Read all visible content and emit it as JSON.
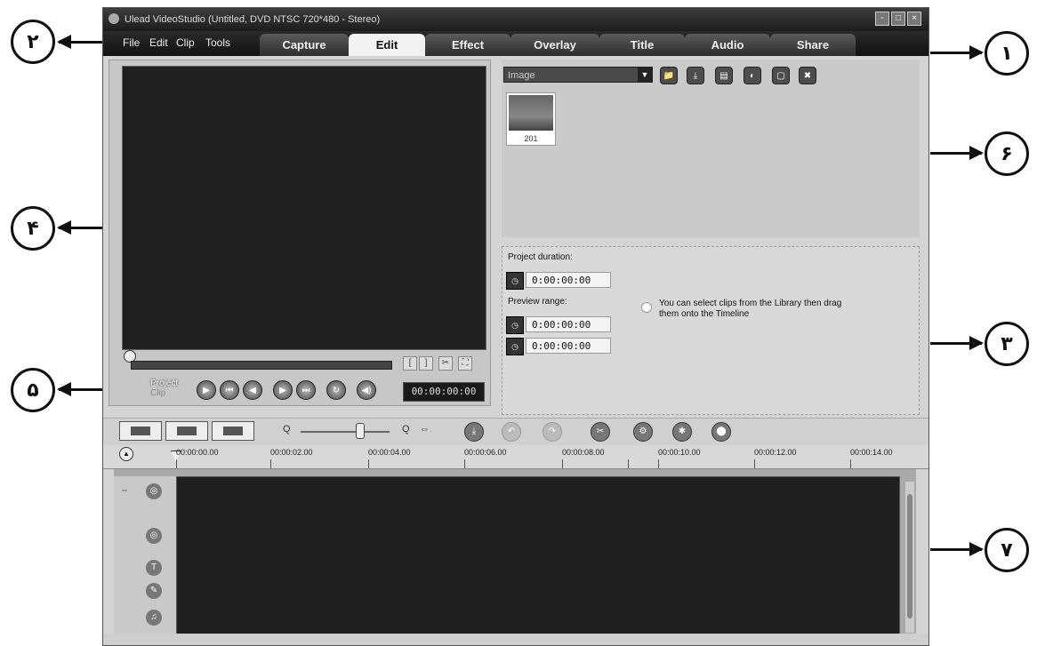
{
  "window": {
    "title": "Ulead VideoStudio (Untitled, DVD NTSC 720*480 - Stereo)",
    "buttons": [
      "-",
      "□",
      "×"
    ]
  },
  "menu": {
    "items": [
      "File",
      "Edit",
      "Clip",
      "Tools"
    ]
  },
  "tabs": {
    "items": [
      "Capture",
      "Edit",
      "Effect",
      "Overlay",
      "Title",
      "Audio",
      "Share"
    ],
    "active": "Edit"
  },
  "preview": {
    "mode_project": "Project",
    "mode_clip": "Clip",
    "timecode": "00:00:00:00",
    "trim_labels": [
      "[",
      "]"
    ],
    "buttons": [
      "play",
      "home",
      "previous-frame",
      "next-frame",
      "end",
      "repeat",
      "volume",
      "enlarge"
    ],
    "button_glyphs": [
      "▶",
      "⏮",
      "◀",
      "▶",
      "⏭",
      "↻",
      "◀)",
      "⛶"
    ]
  },
  "library": {
    "category": "Image",
    "dropdown_glyph": "▼",
    "icon_glyphs": [
      "📁",
      "⤓",
      "▤",
      "◐",
      "▢",
      "✖"
    ],
    "thumbnails": [
      {
        "label": "201"
      }
    ]
  },
  "options": {
    "project_duration_label": "Project duration:",
    "project_duration": "0:00:00:00",
    "preview_range_label": "Preview range:",
    "preview_start": "0:00:00:00",
    "preview_end": "0:00:00:00",
    "hint": "You can select clips from the Library then drag them onto the Timeline",
    "spin_up": "▲",
    "spin_down": "▼"
  },
  "toolbar": {
    "zoom_minus": "Q",
    "zoom_plus": "Q",
    "fit": "⇔",
    "icon_glyphs": [
      "⤓",
      "↶",
      "↷",
      "✂",
      "⚙",
      "✱",
      "⬤"
    ]
  },
  "timeline": {
    "ruler_labels": [
      "00:00:00.00",
      "00:00:02.00",
      "00:00:04.00",
      "00:00:06.00",
      "00:00:08.00",
      "00:00:10.00",
      "00:00:12.00",
      "00:00:14.00"
    ],
    "track_icons": [
      "video",
      "overlay",
      "title",
      "voice",
      "music"
    ],
    "track_glyphs": [
      "◎",
      "◎",
      "T",
      "✎",
      "♫"
    ]
  },
  "callouts": {
    "c1": "۱",
    "c2": "۲",
    "c3": "۳",
    "c4": "۴",
    "c5": "۵",
    "c6": "۶",
    "c7": "۷"
  }
}
